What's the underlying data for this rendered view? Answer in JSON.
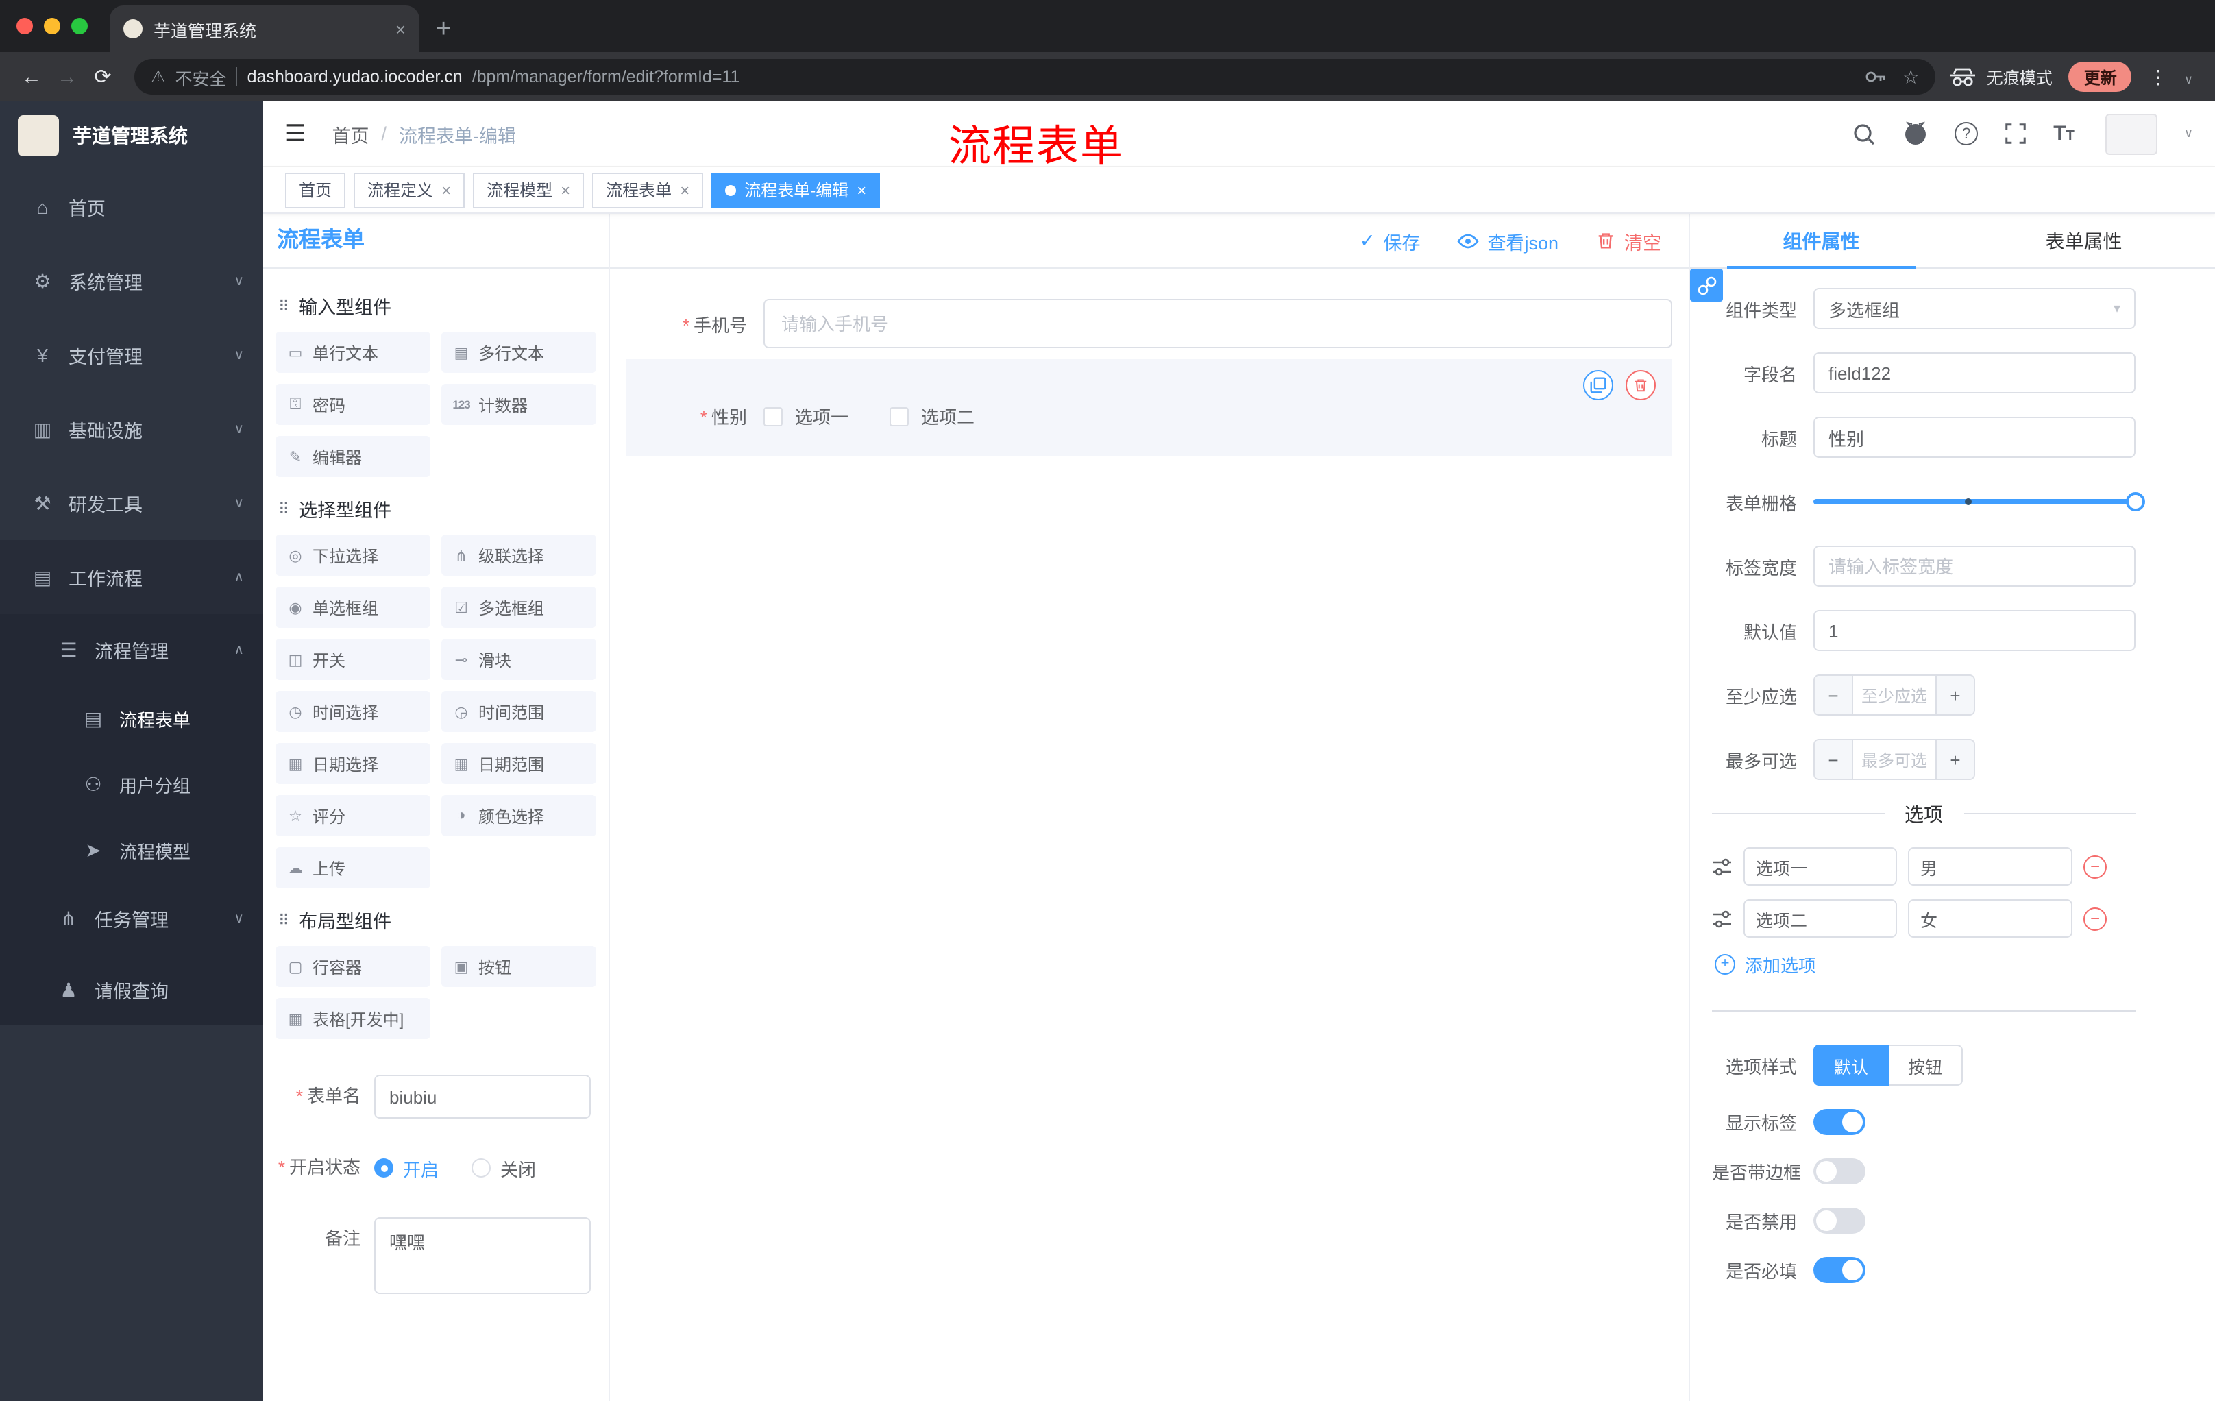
{
  "icons": {
    "home": "⌂",
    "gear": "⚙",
    "yen": "¥",
    "infra": "▥",
    "tools": "⚒",
    "workflow": "▤",
    "list_menu": "☰",
    "doc": "▤",
    "users": "⚇",
    "send": "➤",
    "tasks": "⋔",
    "person": "♟",
    "chevron_down": "∨",
    "chevron_up": "∧",
    "hamburger": "☰",
    "drag_dots": "⠿",
    "back": "←",
    "forward": "→",
    "reload": "⟳",
    "new_tab": "+",
    "close": "×",
    "more_dots": "⋮",
    "warning": "⚠",
    "check": "✓",
    "star": "☆",
    "minus": "−",
    "plus": "+",
    "select_chevron": "▾",
    "question": "?"
  },
  "browser": {
    "tab_title": "芋道管理系统",
    "security_label": "不安全",
    "url_domain": "dashboard.yudao.iocoder.cn",
    "url_path": "/bpm/manager/form/edit?formId=11",
    "incognito_label": "无痕模式",
    "update_label": "更新"
  },
  "sidebar": {
    "logo_title": "芋道管理系统",
    "items": [
      {
        "label": "首页"
      },
      {
        "label": "系统管理"
      },
      {
        "label": "支付管理"
      },
      {
        "label": "基础设施"
      },
      {
        "label": "研发工具"
      },
      {
        "label": "工作流程"
      },
      {
        "label": "流程管理"
      },
      {
        "label": "流程表单"
      },
      {
        "label": "用户分组"
      },
      {
        "label": "流程模型"
      },
      {
        "label": "任务管理"
      },
      {
        "label": "请假查询"
      }
    ]
  },
  "header": {
    "breadcrumb_root": "首页",
    "breadcrumb_sep": "/",
    "breadcrumb_current": "流程表单-编辑",
    "annotation": "流程表单"
  },
  "tags": [
    {
      "label": "首页"
    },
    {
      "label": "流程定义"
    },
    {
      "label": "流程模型"
    },
    {
      "label": "流程表单"
    },
    {
      "label": "流程表单-编辑"
    }
  ],
  "designer": {
    "panel_title": "流程表单",
    "toolbar": {
      "save": "保存",
      "view_json": "查看json",
      "clear": "清空"
    },
    "palette": {
      "sections": [
        {
          "title": "输入型组件",
          "items": [
            {
              "label": "单行文本",
              "icon": "▭"
            },
            {
              "label": "多行文本",
              "icon": "▤"
            },
            {
              "label": "密码",
              "icon": "⚿"
            },
            {
              "label": "计数器",
              "icon": "123"
            },
            {
              "label": "编辑器",
              "icon": "✎"
            }
          ]
        },
        {
          "title": "选择型组件",
          "items": [
            {
              "label": "下拉选择",
              "icon": "◎"
            },
            {
              "label": "级联选择",
              "icon": "⋔"
            },
            {
              "label": "单选框组",
              "icon": "◉"
            },
            {
              "label": "多选框组",
              "icon": "☑"
            },
            {
              "label": "开关",
              "icon": "◫"
            },
            {
              "label": "滑块",
              "icon": "⊸"
            },
            {
              "label": "时间选择",
              "icon": "◷"
            },
            {
              "label": "时间范围",
              "icon": "◶"
            },
            {
              "label": "日期选择",
              "icon": "▦"
            },
            {
              "label": "日期范围",
              "icon": "▦"
            },
            {
              "label": "评分",
              "icon": "☆"
            },
            {
              "label": "颜色选择",
              "icon": "◑"
            },
            {
              "label": "上传",
              "icon": "☁"
            }
          ]
        },
        {
          "title": "布局型组件",
          "items": [
            {
              "label": "行容器",
              "icon": "▢"
            },
            {
              "label": "按钮",
              "icon": "▣"
            },
            {
              "label": "表格[开发中]",
              "icon": "▦"
            }
          ]
        }
      ]
    },
    "meta_form": {
      "form_name_label": "表单名",
      "form_name_value": "biubiu",
      "status_label": "开启状态",
      "status_on": "开启",
      "status_off": "关闭",
      "remark_label": "备注",
      "remark_value": "嘿嘿"
    },
    "canvas": {
      "phone_label": "手机号",
      "phone_placeholder": "请输入手机号",
      "gender_label": "性别",
      "gender_option1": "选项一",
      "gender_option2": "选项二"
    }
  },
  "props": {
    "tab_component": "组件属性",
    "tab_form": "表单属性",
    "component_type_label": "组件类型",
    "component_type_value": "多选框组",
    "field_name_label": "字段名",
    "field_name_value": "field122",
    "title_label": "标题",
    "title_value": "性别",
    "grid_label": "表单栅格",
    "label_width_label": "标签宽度",
    "label_width_placeholder": "请输入标签宽度",
    "default_label": "默认值",
    "default_value": "1",
    "min_label": "至少应选",
    "min_placeholder": "至少应选",
    "max_label": "最多可选",
    "max_placeholder": "最多可选",
    "options_divider": "选项",
    "options": [
      {
        "label": "选项一",
        "value": "男"
      },
      {
        "label": "选项二",
        "value": "女"
      }
    ],
    "add_option": "添加选项",
    "style_label": "选项样式",
    "style_default": "默认",
    "style_button": "按钮",
    "toggle_show_label": "显示标签",
    "toggle_border": "是否带边框",
    "toggle_disabled": "是否禁用",
    "toggle_required": "是否必填"
  }
}
